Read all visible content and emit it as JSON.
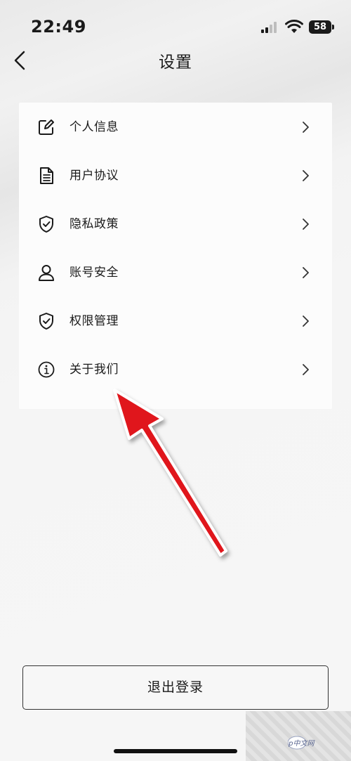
{
  "status_bar": {
    "time": "22:49",
    "battery": "58"
  },
  "header": {
    "title": "设置"
  },
  "settings": {
    "items": [
      {
        "label": "个人信息",
        "icon": "edit-icon"
      },
      {
        "label": "用户协议",
        "icon": "document-icon"
      },
      {
        "label": "隐私政策",
        "icon": "shield-check-icon"
      },
      {
        "label": "账号安全",
        "icon": "user-icon"
      },
      {
        "label": "权限管理",
        "icon": "shield-check-icon"
      },
      {
        "label": "关于我们",
        "icon": "info-icon"
      }
    ]
  },
  "logout": {
    "label": "退出登录"
  },
  "watermark": {
    "text": "php中文网"
  },
  "colors": {
    "annotation_arrow": "#e0141b",
    "text": "#1a1a1a"
  }
}
